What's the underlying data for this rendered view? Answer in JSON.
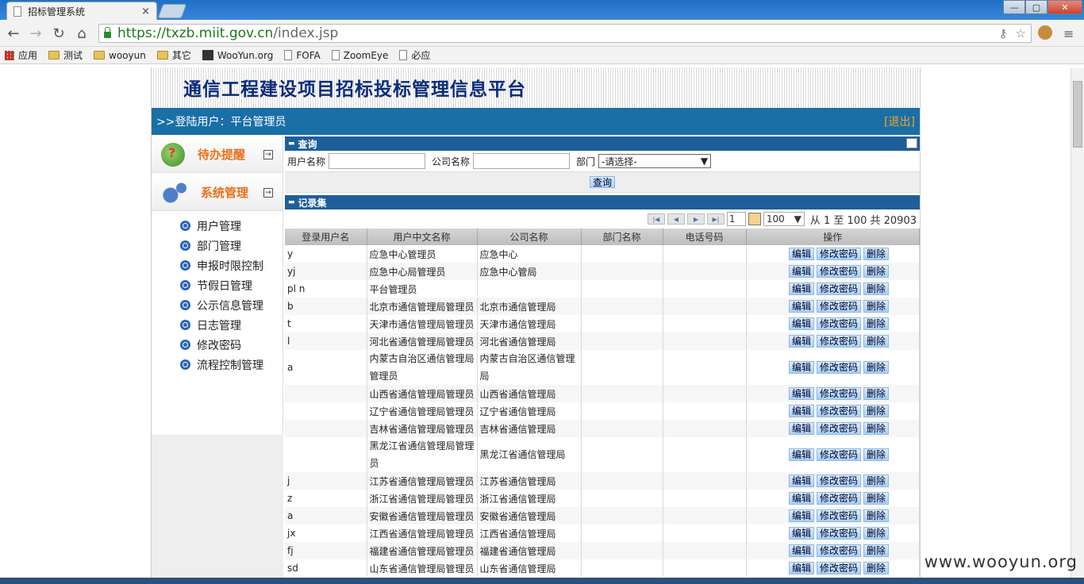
{
  "browser": {
    "tab_title": "招标管理系统",
    "tab_close": "×",
    "url_scheme": "https://",
    "url_host": "txzb.miit.gov.cn",
    "url_path": "/index.jsp",
    "bookmarks": [
      "应用",
      "测试",
      "wooyun",
      "其它",
      "WooYun.org",
      "FOFA",
      "ZoomEye",
      "必应"
    ]
  },
  "header": {
    "site_title": "通信工程建设项目招标投标管理信息平台",
    "login_user": ">>登陆用户：平台管理员",
    "logout": "[退出]"
  },
  "sidebar": {
    "sections": [
      {
        "title": "待办提醒",
        "icon": "question-icon",
        "toggle": "→"
      },
      {
        "title": "系统管理",
        "icon": "gear-icon",
        "toggle": "→"
      }
    ],
    "items": [
      "用户管理",
      "部门管理",
      "申报时限控制",
      "节假日管理",
      "公示信息管理",
      "日志管理",
      "修改密码",
      "流程控制管理"
    ]
  },
  "query": {
    "section_title": "查询",
    "username_label": "用户名称",
    "company_label": "公司名称",
    "dept_label": "部门",
    "dept_value": "-请选择-",
    "submit": "查询"
  },
  "records": {
    "section_title": "记录集",
    "page_value": "1",
    "page_size": "100",
    "summary": "从 1 至 100 共 20903",
    "columns": [
      "登录用户名",
      "用户中文名称",
      "公司名称",
      "部门名称",
      "电话号码",
      "操作"
    ],
    "actions": {
      "edit": "编辑",
      "change_password": "修改密码",
      "delete": "删除"
    },
    "rows": [
      {
        "login": "y",
        "name": "应急中心管理员",
        "company": "应急中心"
      },
      {
        "login": "yj",
        "name": "应急中心局管理员",
        "company": "应急中心管局"
      },
      {
        "login": "pl    n",
        "name": "平台管理员",
        "company": ""
      },
      {
        "login": "b",
        "name": "北京市通信管理局管理员",
        "company": "北京市通信管理局"
      },
      {
        "login": "t",
        "name": "天津市通信管理局管理员",
        "company": "天津市通信管理局"
      },
      {
        "login": "l",
        "name": "河北省通信管理局管理员",
        "company": "河北省通信管理局"
      },
      {
        "login": "    a",
        "name": "内蒙古自治区通信管理局管理员",
        "company": "内蒙古自治区通信管理局",
        "tall": true
      },
      {
        "login": "",
        "name": "山西省通信管理局管理员",
        "company": "山西省通信管理局"
      },
      {
        "login": "",
        "name": "辽宁省通信管理局管理员",
        "company": "辽宁省通信管理局"
      },
      {
        "login": "",
        "name": "吉林省通信管理局管理员",
        "company": "吉林省通信管理局"
      },
      {
        "login": "",
        "name": "黑龙江省通信管理局管理员",
        "company": "黑龙江省通信管理局",
        "tall": true
      },
      {
        "login": "j",
        "name": "江苏省通信管理局管理员",
        "company": "江苏省通信管理局"
      },
      {
        "login": "z",
        "name": "浙江省通信管理局管理员",
        "company": "浙江省通信管理局"
      },
      {
        "login": "a",
        "name": "安徽省通信管理局管理员",
        "company": "安徽省通信管理局"
      },
      {
        "login": "jx",
        "name": "江西省通信管理局管理员",
        "company": "江西省通信管理局"
      },
      {
        "login": "fj",
        "name": "福建省通信管理局管理员",
        "company": "福建省通信管理局"
      },
      {
        "login": "sd",
        "name": "山东省通信管理局管理员",
        "company": "山东省通信管理局"
      }
    ]
  },
  "watermark": "www.wooyun.org"
}
